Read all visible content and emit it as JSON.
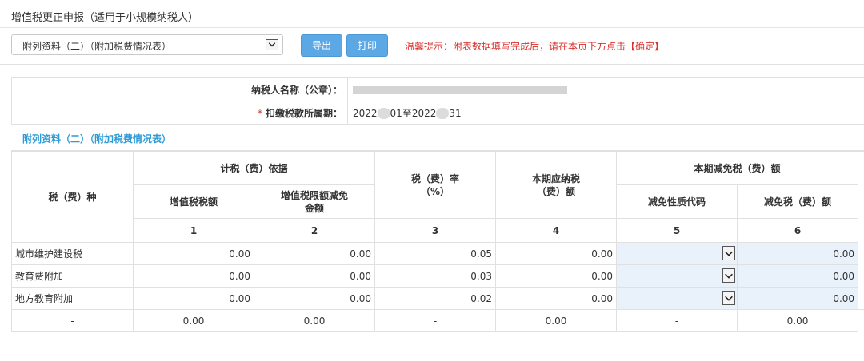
{
  "header": {
    "title": "增值税更正申报（适用于小规模纳税人）"
  },
  "toolbar": {
    "form_select_value": "附列资料（二）（附加税费情况表）",
    "export_label": "导出",
    "print_label": "打印",
    "hint_text": "温馨提示：附表数据填写完成后，请在本页下方点击【确定】"
  },
  "info": {
    "taxpayer_label": "纳税人名称（公章）：",
    "period_required_mark": "*",
    "period_label": "扣缴税款所属期：",
    "period_start_prefix": "2022",
    "period_start_suffix": "01至2022",
    "period_end_suffix": "31"
  },
  "attachment": {
    "title": "附列资料（二）（附加税费情况表）"
  },
  "table": {
    "headers": {
      "tax_type": "税（费）种",
      "basis_group": "计税（费）依据",
      "vat_amount": "增值税税额",
      "vat_limit_reduction": "增值税限额减免金额",
      "rate": "税（费）率（%）",
      "payable": "本期应纳税（费）额",
      "reduction_group": "本期减免税（费）额",
      "reduction_code": "减免性质代码",
      "reduction_amount": "减免税（费）额"
    },
    "column_numbers": [
      "1",
      "2",
      "3",
      "4",
      "5",
      "6"
    ],
    "rows": [
      {
        "name": "城市维护建设税",
        "vat_amount": "0.00",
        "vat_limit_reduction": "0.00",
        "rate": "0.05",
        "payable": "0.00",
        "reduction_code": "",
        "reduction_amount": "0.00"
      },
      {
        "name": "教育费附加",
        "vat_amount": "0.00",
        "vat_limit_reduction": "0.00",
        "rate": "0.03",
        "payable": "0.00",
        "reduction_code": "",
        "reduction_amount": "0.00"
      },
      {
        "name": "地方教育附加",
        "vat_amount": "0.00",
        "vat_limit_reduction": "0.00",
        "rate": "0.02",
        "payable": "0.00",
        "reduction_code": "",
        "reduction_amount": "0.00"
      }
    ],
    "total_row": {
      "name": "-",
      "vat_amount": "0.00",
      "vat_limit_reduction": "0.00",
      "rate": "-",
      "payable": "0.00",
      "reduction_code": "-",
      "reduction_amount": "0.00"
    }
  }
}
